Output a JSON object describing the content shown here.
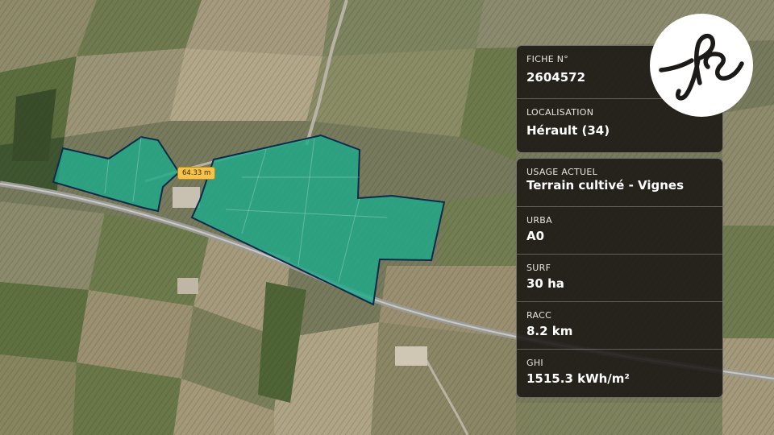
{
  "measure": {
    "label": "64.33 m"
  },
  "info_top": [
    {
      "label": "FICHE N°",
      "value": "2604572"
    },
    {
      "label": "LOCALISATION",
      "value": "Hérault (34)"
    }
  ],
  "info_bottom": [
    {
      "label": "USAGE ACTUEL",
      "value": "Terrain cultivé - Vignes"
    },
    {
      "label": "URBA",
      "value": "A0"
    },
    {
      "label": "SURF",
      "value": "30 ha"
    },
    {
      "label": "RACC",
      "value": "8.2 km"
    },
    {
      "label": "GHI",
      "value": "1515.3 kWh/m²"
    }
  ],
  "colors": {
    "parcel_fill": "#1fa98a",
    "parcel_stroke": "#0f2b4a",
    "panel_bg": "#181412",
    "tag_bg": "#f5c24b"
  },
  "logo": {
    "icon": "fs-monogram-logo"
  }
}
